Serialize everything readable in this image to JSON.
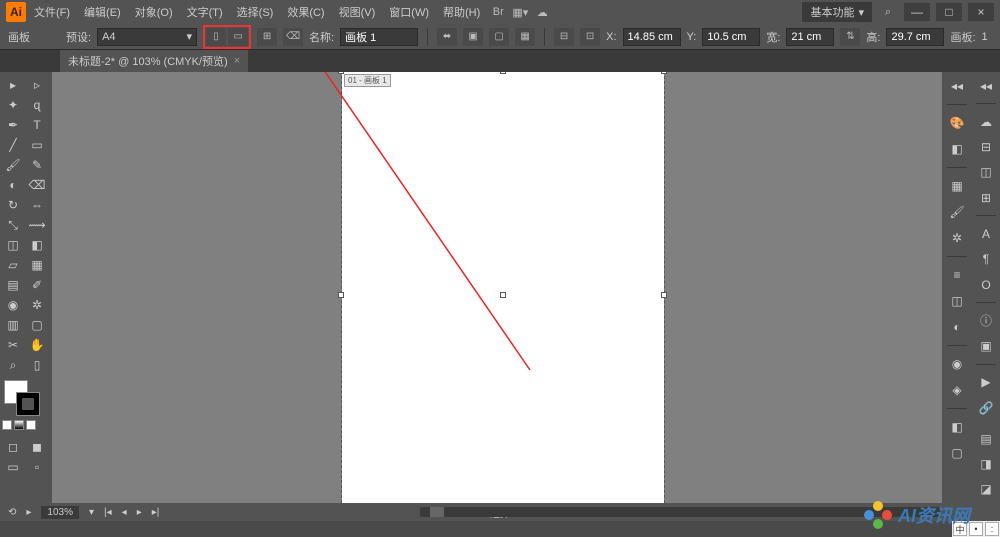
{
  "app": {
    "logo": "Ai"
  },
  "menu": {
    "file": "文件(F)",
    "edit": "编辑(E)",
    "object": "对象(O)",
    "text": "文字(T)",
    "select": "选择(S)",
    "effect": "效果(C)",
    "view": "视图(V)",
    "window": "窗口(W)",
    "help": "帮助(H)"
  },
  "workspace": {
    "label": "基本功能",
    "dropdown": "▾"
  },
  "window_controls": {
    "min": "—",
    "max": "□",
    "close": "×"
  },
  "control": {
    "artboard_label": "画板",
    "preset_label": "预设:",
    "preset_value": "A4",
    "name_label": "名称:",
    "name_value": "画板 1",
    "x_label": "X:",
    "x_value": "14.85 cm",
    "y_label": "Y:",
    "y_value": "10.5 cm",
    "w_label": "宽:",
    "w_value": "21 cm",
    "h_label": "高:",
    "h_value": "29.7 cm",
    "artboards_label": "画板:",
    "artboards_value": "1"
  },
  "tab": {
    "title": "未标题-2* @ 103% (CMYK/预览)",
    "close": "×"
  },
  "canvas": {
    "artboard_label": "01 - 画板 1"
  },
  "status": {
    "zoom": "103%",
    "mode": "选择"
  },
  "watermark": {
    "text": "AI资讯网"
  },
  "lang": {
    "ch": "中",
    "dot": "•",
    "sq": ":"
  }
}
